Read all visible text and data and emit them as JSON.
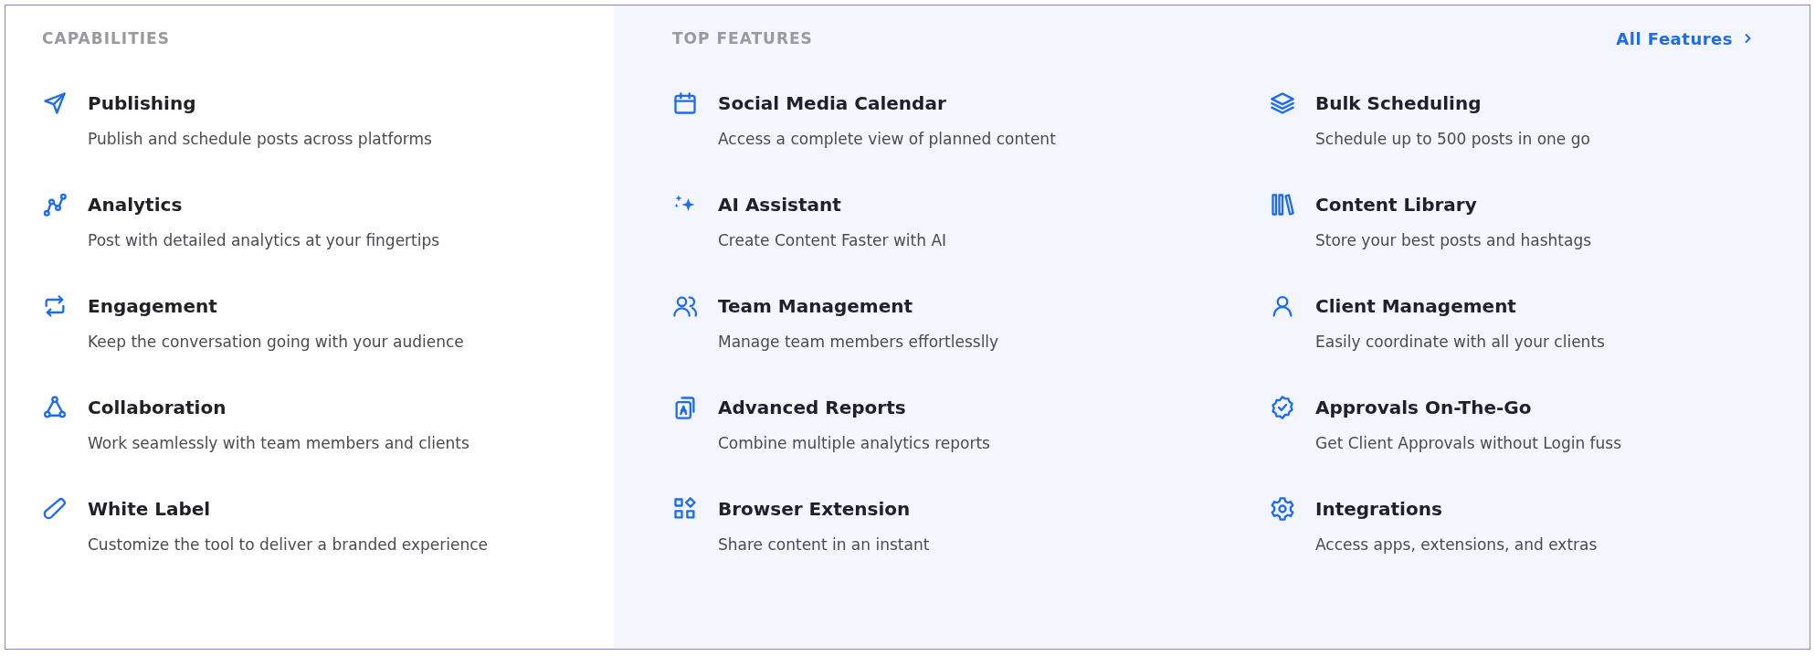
{
  "capabilities": {
    "heading": "CAPABILITIES",
    "items": [
      {
        "title": "Publishing",
        "description": "Publish and schedule posts across platforms"
      },
      {
        "title": "Analytics",
        "description": "Post with detailed analytics at your fingertips"
      },
      {
        "title": "Engagement",
        "description": "Keep the conversation going with your audience"
      },
      {
        "title": "Collaboration",
        "description": "Work seamlessly with team members and clients"
      },
      {
        "title": "White Label",
        "description": "Customize the tool to deliver a branded experience"
      }
    ]
  },
  "top_features": {
    "heading": "TOP FEATURES",
    "link": "All Features",
    "items": [
      {
        "title": "Social Media Calendar",
        "description": "Access a complete view of planned content"
      },
      {
        "title": "Bulk Scheduling",
        "description": "Schedule up to 500 posts in one go"
      },
      {
        "title": "AI Assistant",
        "description": "Create Content Faster with AI"
      },
      {
        "title": "Content Library",
        "description": "Store your best posts and hashtags"
      },
      {
        "title": "Team Management",
        "description": "Manage team members effortlesslly"
      },
      {
        "title": "Client Management",
        "description": "Easily coordinate with all your clients"
      },
      {
        "title": "Advanced Reports",
        "description": "Combine multiple analytics reports"
      },
      {
        "title": "Approvals On-The-Go",
        "description": "Get Client Approvals without Login fuss"
      },
      {
        "title": "Browser Extension",
        "description": "Share content in an instant"
      },
      {
        "title": "Integrations",
        "description": "Access apps, extensions, and extras"
      }
    ]
  }
}
